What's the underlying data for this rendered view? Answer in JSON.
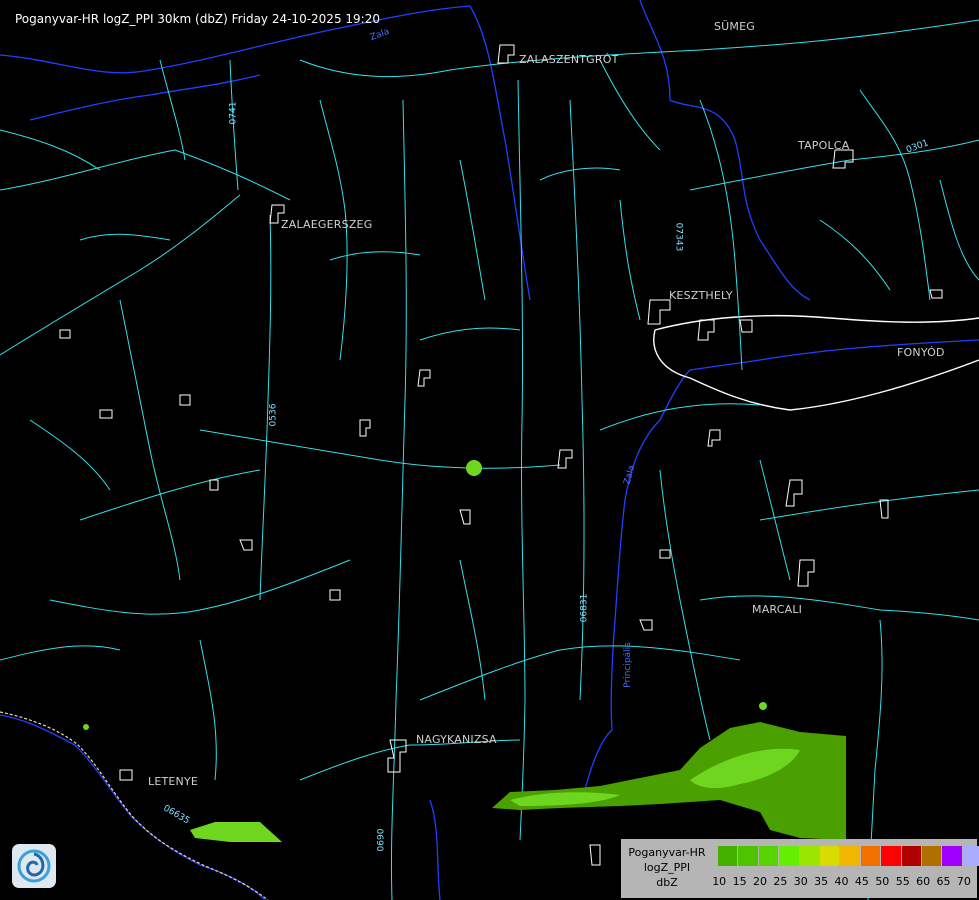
{
  "header": {
    "title": "Poganyvar-HR logZ_PPI 30km (dbZ) Friday 24-10-2025 19:20"
  },
  "towns": [
    {
      "id": "sumeg",
      "name": "SÜMEG"
    },
    {
      "id": "zalaszentgrot",
      "name": "ZALASZENTGRÓT"
    },
    {
      "id": "tapolca",
      "name": "TAPOLCA"
    },
    {
      "id": "zalaegerszeg",
      "name": "ZALAEGERSZEG"
    },
    {
      "id": "keszthely",
      "name": "KESZTHELY"
    },
    {
      "id": "fonyod",
      "name": "FONYÓD"
    },
    {
      "id": "marcali",
      "name": "MARCALI"
    },
    {
      "id": "nagykanizsa",
      "name": "NAGYKANIZSA"
    },
    {
      "id": "letenye",
      "name": "LETENYE"
    }
  ],
  "road_labels": [
    "0741",
    "07343",
    "0301",
    "0536",
    "06831",
    "06635",
    "0690"
  ],
  "water_labels": [
    "Zala",
    "Zala",
    "Principális"
  ],
  "legend": {
    "title_line1": "Poganyvar-HR",
    "title_line2": "logZ_PPI",
    "unit": "dbZ",
    "ticks": [
      "10",
      "15",
      "20",
      "25",
      "30",
      "35",
      "40",
      "45",
      "50",
      "55",
      "60",
      "65",
      "70"
    ],
    "colors": [
      "#44b000",
      "#4dc400",
      "#55d400",
      "#66ee00",
      "#9ae600",
      "#d9dc00",
      "#f2b600",
      "#f07000",
      "#ff0000",
      "#b00000",
      "#b07000",
      "#a000ff",
      "#aaaaff"
    ]
  },
  "colors": {
    "background": "#000000",
    "roads": "#33e0ea",
    "rivers": "#2244ff",
    "settlements": "#ffffff",
    "echo_light": "#6fd620",
    "echo_dark": "#4aa000"
  }
}
